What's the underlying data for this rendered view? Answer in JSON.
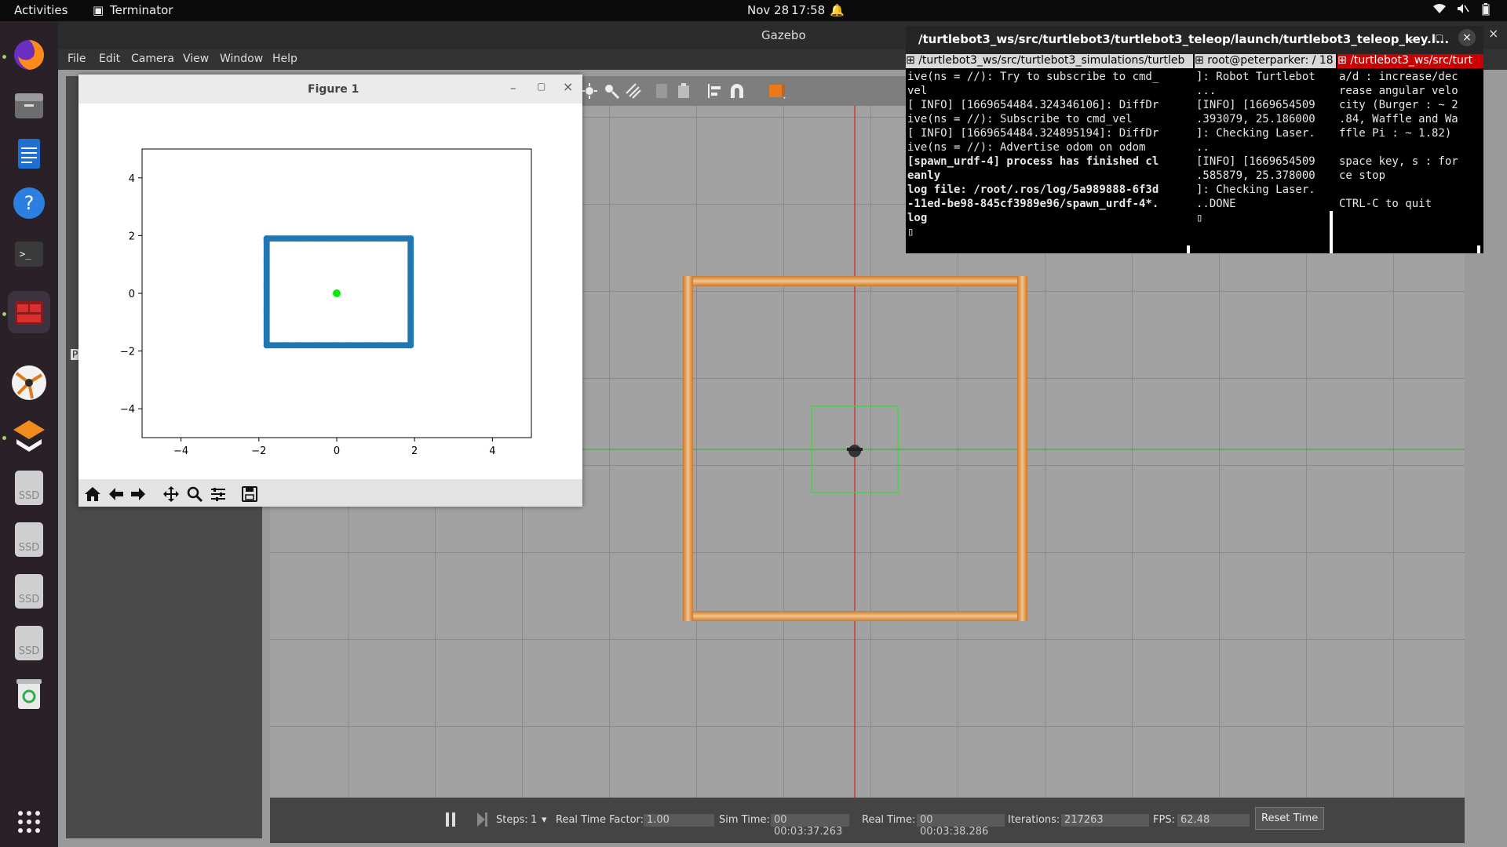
{
  "topbar": {
    "activities": "Activities",
    "app": "Terminator",
    "date": "Nov 28",
    "time": "17:58"
  },
  "gazebo": {
    "title": "Gazebo",
    "menu": [
      "File",
      "Edit",
      "Camera",
      "View",
      "Window",
      "Help"
    ],
    "left_letter": "P",
    "bottom": {
      "steps_label": "Steps:",
      "steps_value": "1",
      "rtf_label": "Real Time Factor:",
      "rtf_value": "1.00",
      "sim_label": "Sim Time:",
      "sim_value": "00 00:03:37.263",
      "real_label": "Real Time:",
      "real_value": "00 00:03:38.286",
      "iter_label": "Iterations:",
      "iter_value": "217263",
      "fps_label": "FPS:",
      "fps_value": "62.48",
      "reset_label": "Reset Time"
    }
  },
  "figure": {
    "title": "Figure 1",
    "chart_data": {
      "type": "scatter",
      "xlim": [
        -5,
        5
      ],
      "ylim": [
        -5,
        5
      ],
      "xticks": [
        -4,
        -2,
        0,
        2,
        4
      ],
      "yticks": [
        4,
        2,
        0,
        -2,
        -4
      ],
      "tick_labels_x": [
        "−4",
        "−2",
        "0",
        "2",
        "4"
      ],
      "tick_labels_y": [
        "4",
        "2",
        "0",
        "−2",
        "−4"
      ],
      "series": [
        {
          "color": "#1f77b4",
          "shape": "rectangle outline",
          "x": [
            -1.8,
            1.9,
            1.9,
            -1.8,
            -1.8
          ],
          "y": [
            1.9,
            1.9,
            -1.8,
            -1.8,
            1.9
          ]
        },
        {
          "color": "#00ee00",
          "points": [
            [
              0,
              0
            ]
          ]
        }
      ]
    }
  },
  "terminal": {
    "title": "/turtlebot3_ws/src/turtlebot3/turtlebot3_teleop/launch/turtlebot3_teleop_key.l...",
    "panes": [
      {
        "head": "/turtlebot3_ws/src/turtlebot3_simulations/turtleb",
        "lines": [
          "ive(ns = //): Try to subscribe to cmd_",
          "vel",
          "[ INFO] [1669654484.324346106]: DiffDr",
          "ive(ns = //): Subscribe to cmd_vel",
          "[ INFO] [1669654484.324895194]: DiffDr",
          "ive(ns = //): Advertise odom on odom",
          "[spawn_urdf-4] process has finished cl",
          "eanly",
          "log file: /root/.ros/log/5a989888-6f3d",
          "-11ed-be98-845cf3989e96/spawn_urdf-4*.",
          "log",
          "▯"
        ]
      },
      {
        "head": "root@peterparker: / 18",
        "lines": [
          "]: Robot Turtlebot",
          "...",
          "[INFO] [1669654509",
          ".393079, 25.186000",
          "]: Checking Laser.",
          "..",
          "[INFO] [1669654509",
          ".585879, 25.378000",
          "]: Checking Laser.",
          "..DONE",
          "▯"
        ]
      },
      {
        "head": "/turtlebot3_ws/src/turt",
        "lines": [
          "a/d : increase/dec",
          "rease angular velo",
          "city (Burger : ~ 2",
          ".84, Waffle and Wa",
          "ffle Pi : ~ 1.82)",
          "",
          "space key, s : for",
          "ce stop",
          "",
          "CTRL-C to quit"
        ]
      }
    ]
  },
  "dock": {
    "ssd_label": "SSD"
  },
  "colors": {
    "accent_red": "#cc0000",
    "plot_blue": "#1f77b4",
    "plot_green": "#00ee00",
    "wall_orange": "#e59a4a"
  }
}
